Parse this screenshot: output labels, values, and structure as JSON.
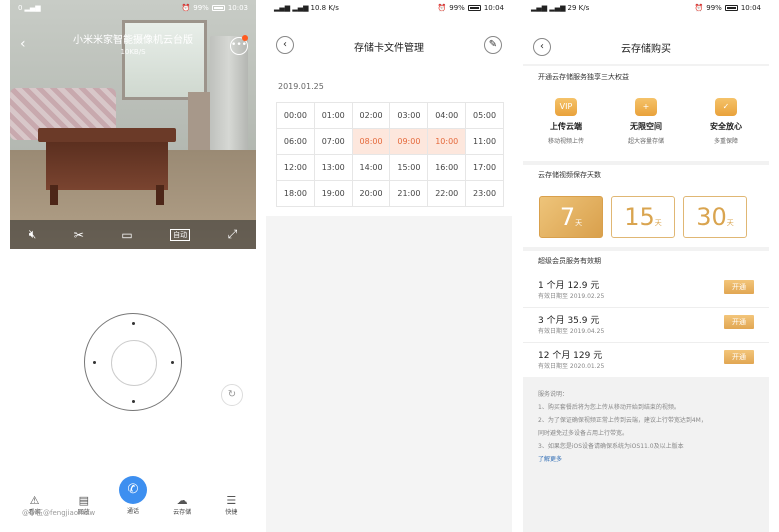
{
  "screen1": {
    "status": {
      "left": "0",
      "battery": "99%",
      "time": "10:03"
    },
    "title": "小米米家智能摄像机云台版",
    "speed": "10KB/S",
    "video_controls": {
      "auto_label": "自动"
    },
    "tabs": [
      {
        "label": "看家",
        "icon": "alarm-icon"
      },
      {
        "label": "回放",
        "icon": "playback-icon"
      },
      {
        "label": "通话",
        "icon": "phone-icon"
      },
      {
        "label": "云存储",
        "icon": "cloud-icon"
      },
      {
        "label": "快捷",
        "icon": "menu-icon"
      }
    ],
    "watermark": "@小伍@fengjiaomuw"
  },
  "screen2": {
    "status": {
      "signal": "10.8 K/s",
      "battery": "99%",
      "time": "10:04"
    },
    "title": "存储卡文件管理",
    "date": "2019.01.25",
    "hours": [
      "00:00",
      "01:00",
      "02:00",
      "03:00",
      "04:00",
      "05:00",
      "06:00",
      "07:00",
      "08:00",
      "09:00",
      "10:00",
      "11:00",
      "12:00",
      "13:00",
      "14:00",
      "15:00",
      "16:00",
      "17:00",
      "18:00",
      "19:00",
      "20:00",
      "21:00",
      "22:00",
      "23:00"
    ],
    "highlighted": [
      "08:00",
      "09:00",
      "10:00"
    ],
    "highlight_color": "#fde7dd"
  },
  "screen3": {
    "status": {
      "signal": "29 K/s",
      "battery": "99%",
      "time": "10:04"
    },
    "title": "云存储购买",
    "benefits_title": "开通云存储服务独享三大权益",
    "benefits": [
      {
        "title": "上传云端",
        "sub": "移动视频上传",
        "badge": "VIP"
      },
      {
        "title": "无限空间",
        "sub": "超大容量存储",
        "badge": "+"
      },
      {
        "title": "安全放心",
        "sub": "多重保障",
        "badge": "✓"
      }
    ],
    "days_title": "云存储视频保存天数",
    "days": [
      {
        "n": "7",
        "u": "天"
      },
      {
        "n": "15",
        "u": "天"
      },
      {
        "n": "30",
        "u": "天"
      }
    ],
    "plans_title": "超级会员服务有效期",
    "plans": [
      {
        "name": "1 个月   12.9 元",
        "expiry": "有效日期至 2019.02.25",
        "button": "开通"
      },
      {
        "name": "3 个月   35.9 元",
        "expiry": "有效日期至 2019.04.25",
        "button": "开通"
      },
      {
        "name": "12 个月   129 元",
        "expiry": "有效日期至 2020.01.25",
        "button": "开通"
      }
    ],
    "notes": {
      "title": "服务说明：",
      "items": [
        "1、购买套餐后将为您上传从移动开始到结束的视频。",
        "2、为了保证确保视频正常上传到云端，建议上行带宽达到4M，",
        "同时避免过多设备占用上行带宽。",
        "3、如果您是iOS设备请确保系统为iOS11.0及以上版本"
      ],
      "more": "了解更多"
    },
    "accent": "#e1a652"
  }
}
